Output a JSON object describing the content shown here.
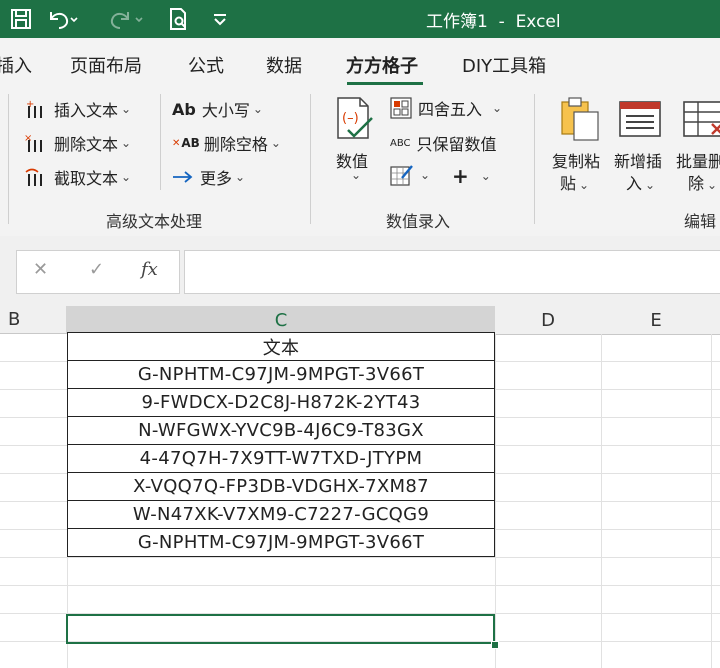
{
  "window": {
    "title": "工作簿1  -  Excel"
  },
  "quick_access": {
    "icons": [
      "save-icon",
      "undo-icon",
      "redo-icon",
      "print-preview-icon",
      "customize-qat-icon"
    ]
  },
  "tabs": [
    {
      "label": "插入",
      "active": false
    },
    {
      "label": "页面布局",
      "active": false
    },
    {
      "label": "公式",
      "active": false
    },
    {
      "label": "数据",
      "active": false
    },
    {
      "label": "方方格子",
      "active": true
    },
    {
      "label": "DIY工具箱",
      "active": false
    }
  ],
  "ribbon": {
    "text_group": {
      "label": "高级文本处理",
      "insert_text": "插入文本",
      "delete_text": "删除文本",
      "extract_text": "截取文本",
      "case": "大小写",
      "case_icon": "Ab",
      "delete_spaces": "删除空格",
      "delete_spaces_icon": "AB",
      "more": "更多"
    },
    "value_group": {
      "label": "数值录入",
      "numeric": "数值",
      "round": "四舍五入",
      "keep_numbers": "只保留数值",
      "keep_numbers_icon": "ABC",
      "plus": "+"
    },
    "edit_group": {
      "label": "编辑",
      "copy_paste": [
        "复制粘",
        "贴"
      ],
      "insert_new": [
        "新增插",
        "入"
      ],
      "batch_delete": [
        "批量删",
        "除"
      ]
    }
  },
  "formula_bar": {
    "cancel": "✕",
    "enter": "✓",
    "fx": "fx",
    "value": ""
  },
  "columns": [
    "B",
    "C",
    "D",
    "E"
  ],
  "selected_column": "C",
  "table": {
    "header": "文本",
    "rows": [
      "G-NPHTM-C97JM-9MPGT-3V66T",
      "9-FWDCX-D2C8J-H872K-2YT43",
      "N-WFGWX-YVC9B-4J6C9-T83GX",
      "4-47Q7H-7X9TT-W7TXD-JTYPM",
      "X-VQQ7Q-FP3DB-VDGHX-7XM87",
      "W-N47XK-V7XM9-C7227-GCQG9",
      "G-NPHTM-C97JM-9MPGT-3V66T"
    ]
  },
  "colors": {
    "accent": "#1e7145",
    "ribbon_bg": "#f3f3f3",
    "grid_line": "#e1e1e1"
  }
}
